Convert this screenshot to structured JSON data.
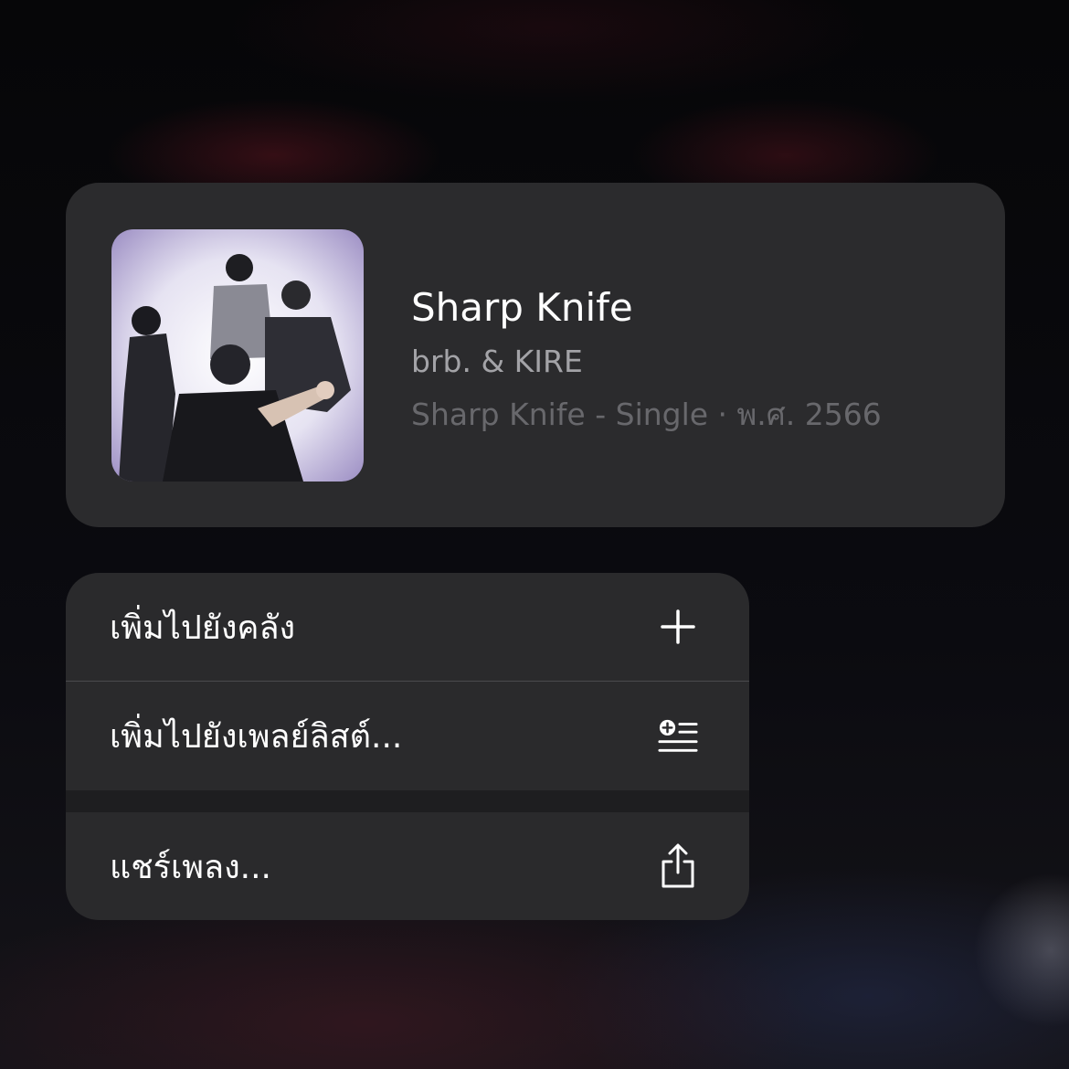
{
  "song": {
    "title": "Sharp Knife",
    "artist": "brb. & KIRE",
    "meta": "Sharp Knife - Single · พ.ศ. 2566"
  },
  "menu": {
    "items": [
      {
        "label": "เพิ่มไปยังคลัง",
        "icon": "plus-icon"
      },
      {
        "label": "เพิ่มไปยังเพลย์ลิสต์...",
        "icon": "add-to-playlist-icon"
      },
      {
        "label": "แชร์เพลง...",
        "icon": "share-icon"
      }
    ]
  },
  "colors": {
    "card_background": "#2b2b2d",
    "menu_background": "#2a2a2c",
    "primary_text": "#ffffff",
    "secondary_text": "#a3a3a7",
    "tertiary_text": "#68686c"
  }
}
